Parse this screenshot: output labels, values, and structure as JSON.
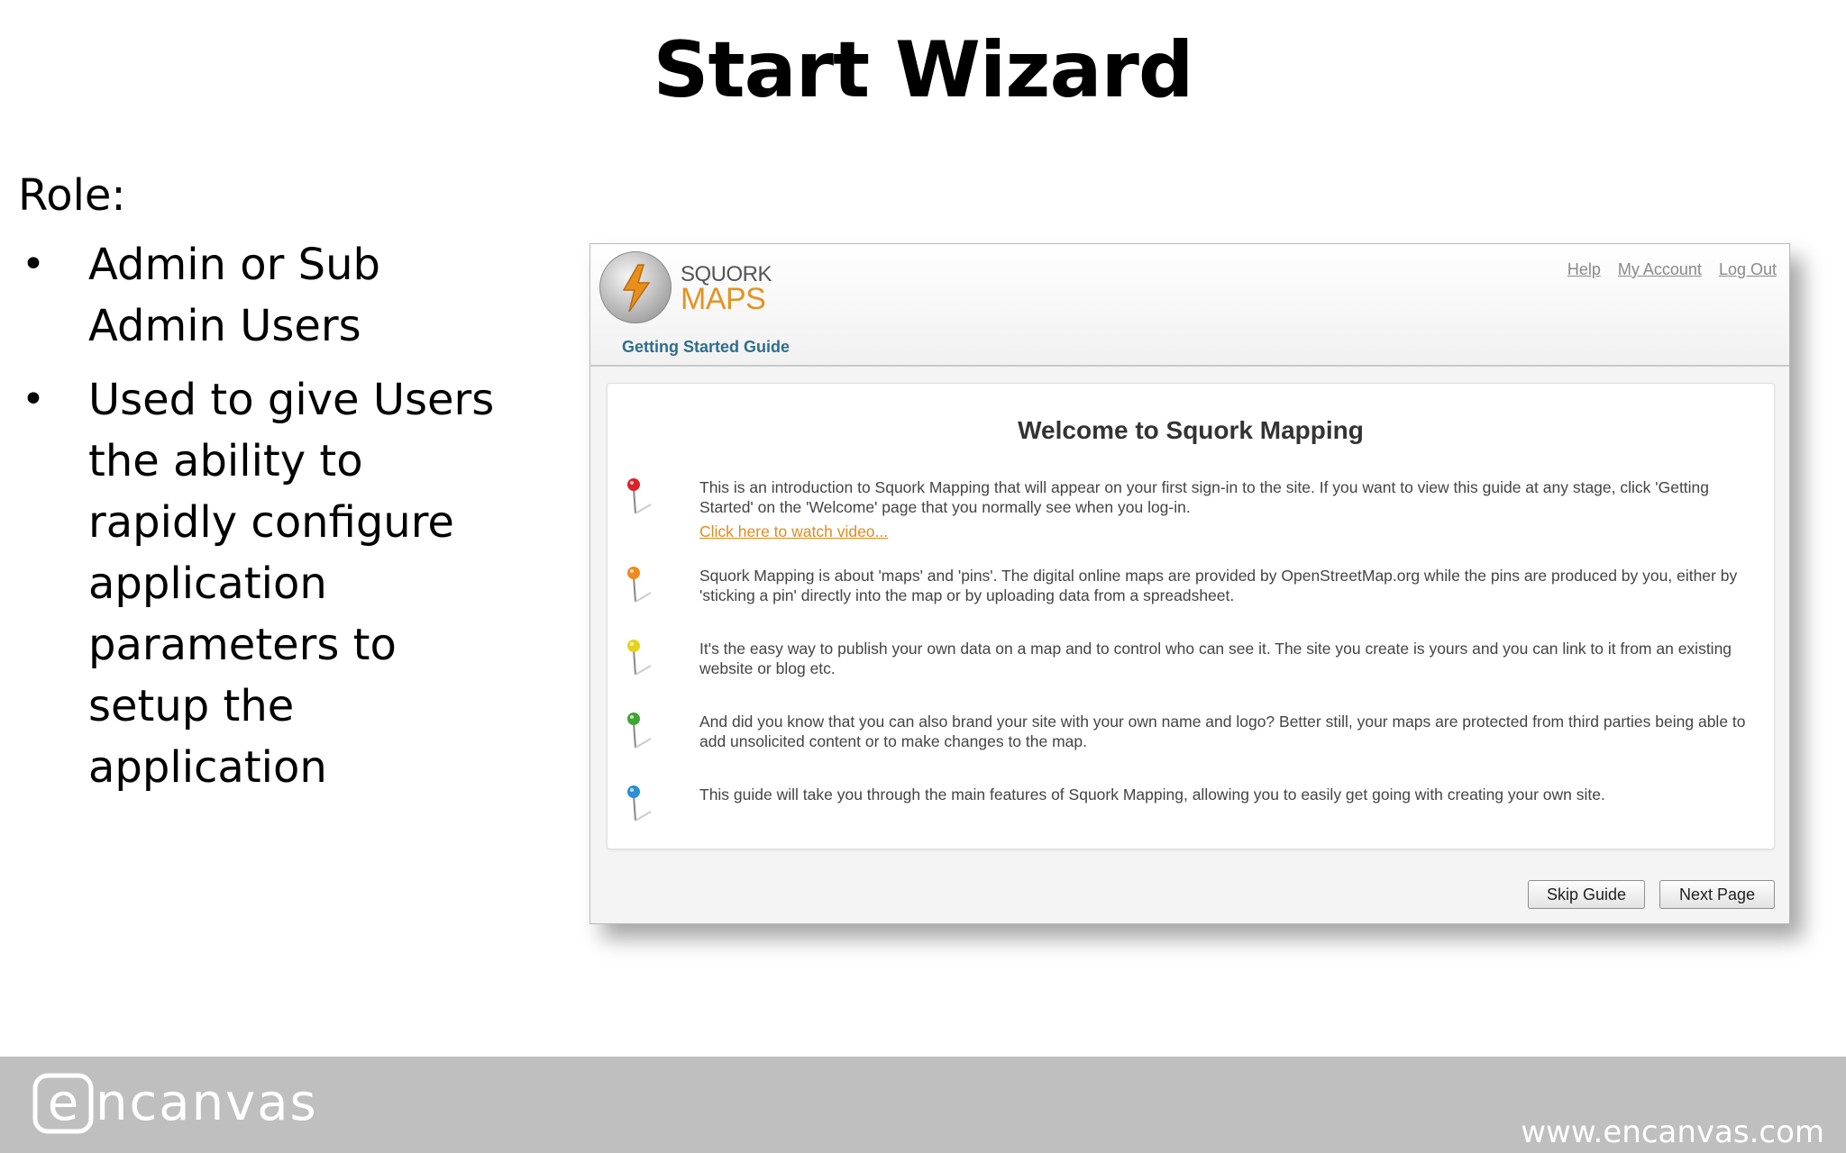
{
  "slide": {
    "title": "Start Wizard",
    "role_label": "Role:",
    "bullets": [
      "Admin or Sub Admin Users",
      "Used to give Users the ability to rapidly configure application parameters to setup the application"
    ]
  },
  "app": {
    "logo_word1": "SQUORK",
    "logo_word2": "MAPS",
    "links": {
      "help": "Help",
      "account": "My Account",
      "logout": "Log Out"
    },
    "guide_label": "Getting Started Guide",
    "welcome_title": "Welcome to Squork Mapping",
    "items": [
      {
        "pin_color": "#d8232a",
        "text": "This is an introduction to Squork Mapping that will appear on your first sign-in to the site. If you want to view this guide at any stage, click 'Getting Started' on the 'Welcome' page that you normally see when you log-in.",
        "link": "Click here to watch video..."
      },
      {
        "pin_color": "#f08a1c",
        "text": "Squork Mapping is about 'maps' and 'pins'. The digital online maps are provided by OpenStreetMap.org while the pins are produced by you, either by 'sticking a pin' directly into the map or by uploading data from a spreadsheet."
      },
      {
        "pin_color": "#e6d21e",
        "text": "It's the easy way to publish your own data on a map and to control who can see it. The site you create is yours and you can link to it from an existing website or blog etc."
      },
      {
        "pin_color": "#3fa535",
        "text": "And did you know that you can also brand your site with your own name and logo? Better still, your maps are protected from third parties being able to add unsolicited content or to make changes to the map."
      },
      {
        "pin_color": "#2b8fd1",
        "text": "This guide will take you through the main features of Squork Mapping, allowing you to easily get going with creating your own site."
      }
    ],
    "buttons": {
      "skip": "Skip Guide",
      "next": "Next Page"
    }
  },
  "footer": {
    "brand": "encanvas",
    "url": "www.encanvas.com"
  }
}
